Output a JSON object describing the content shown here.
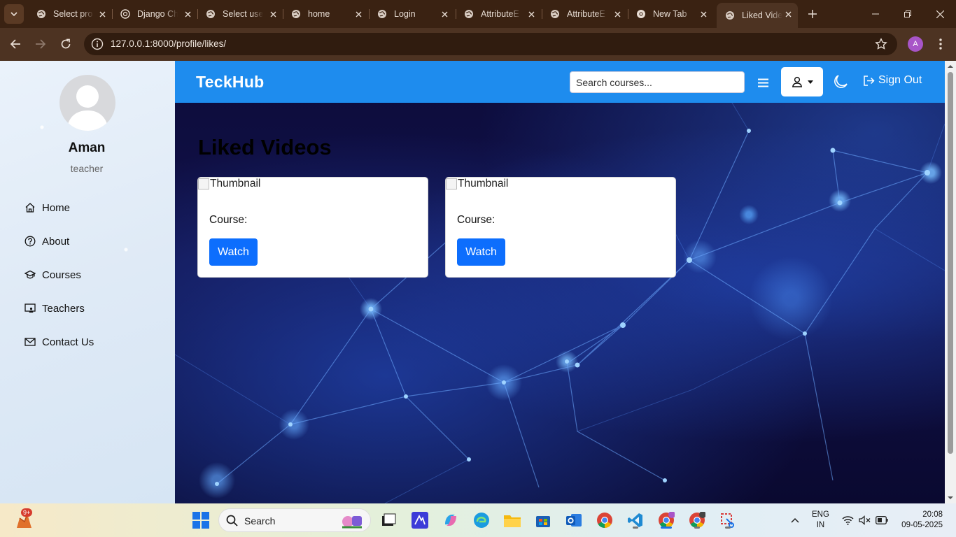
{
  "browser": {
    "tabs": [
      {
        "title": "Select pro",
        "favicon": "globe-icon"
      },
      {
        "title": "Django Ch",
        "favicon": "chatgpt-icon"
      },
      {
        "title": "Select use",
        "favicon": "globe-icon"
      },
      {
        "title": "home",
        "favicon": "globe-icon"
      },
      {
        "title": "Login",
        "favicon": "globe-icon"
      },
      {
        "title": "AttributeE",
        "favicon": "globe-icon"
      },
      {
        "title": "AttributeE",
        "favicon": "globe-icon"
      },
      {
        "title": "New Tab",
        "favicon": "chrome-icon"
      },
      {
        "title": "Liked Vide",
        "favicon": "globe-icon",
        "active": true
      }
    ],
    "url": "127.0.0.1:8000/profile/likes/",
    "profile_initial": "A",
    "accent": "#4d3322"
  },
  "sidebar": {
    "user_name": "Aman",
    "user_role": "teacher",
    "items": [
      {
        "label": "Home",
        "icon": "home-icon"
      },
      {
        "label": "About",
        "icon": "question-circle-icon"
      },
      {
        "label": "Courses",
        "icon": "graduation-cap-icon"
      },
      {
        "label": "Teachers",
        "icon": "chalkboard-teacher-icon"
      },
      {
        "label": "Contact Us",
        "icon": "envelope-icon"
      }
    ]
  },
  "navbar": {
    "brand": "TeckHub",
    "search_placeholder": "Search courses...",
    "signout_label": "Sign Out",
    "color": "#1e8cee"
  },
  "main": {
    "title": "Liked Videos",
    "cards": [
      {
        "thumbnail_alt": "Thumbnail",
        "course_label": "Course:",
        "watch_label": "Watch"
      },
      {
        "thumbnail_alt": "Thumbnail",
        "course_label": "Course:",
        "watch_label": "Watch"
      }
    ],
    "button_color": "#0d6efd"
  },
  "taskbar": {
    "search_label": "Search",
    "notification_badge": "9+",
    "lang_top": "ENG",
    "lang_bottom": "IN",
    "time": "20:08",
    "date": "09-05-2025"
  }
}
